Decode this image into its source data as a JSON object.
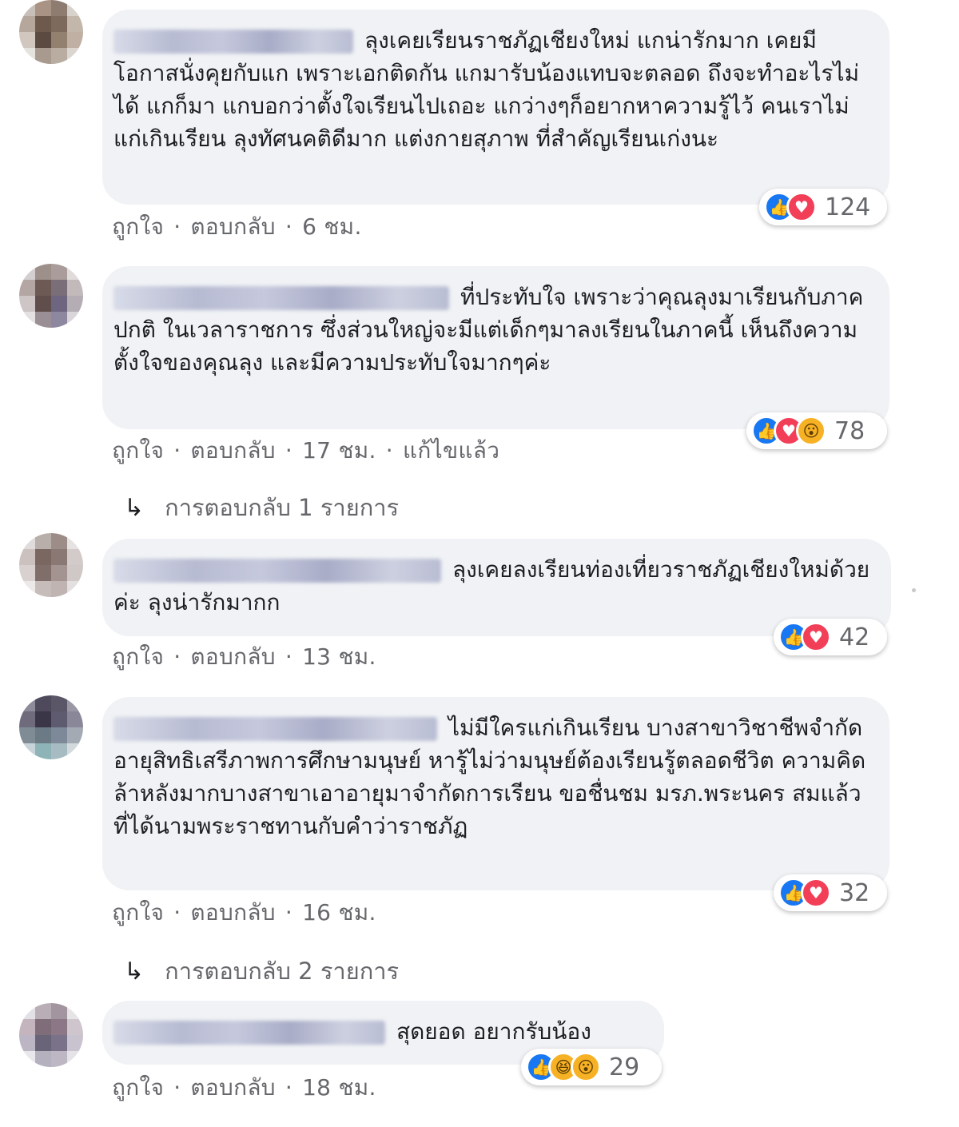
{
  "comments": [
    {
      "text": "ลุงเคยเรียนราชภัฏเชียงใหม่ แกน่ารักมาก เคยมีโอกาสนั่งคุยกับแก เพราะเอกติดกัน แกมารับน้องแทบจะตลอด ถึงจะทำอะไรไม่ได้ แกก็มา แกบอกว่าตั้งใจเรียนไปเถอะ แกว่างๆก็อยากหาความรู้ไว้ คนเราไม่แก่เกินเรียน ลุงทัศนคติดีมาก แต่งกายสุภาพ ที่สำคัญเรียนเก่งนะ",
      "like_label": "ถูกใจ",
      "reply_label": "ตอบกลับ",
      "time": "6 ชม.",
      "reactions": [
        "like",
        "love"
      ],
      "reaction_count": "124"
    },
    {
      "text": "ที่ประทับใจ เพราะว่าคุณลุงมาเรียนกับภาคปกติ ในเวลาราชการ ซึ่งส่วนใหญ่จะมีแต่เด็กๆมาลงเรียนในภาคนี้ เห็นถึงความตั้งใจของคุณลุง และมีความประทับใจมากๆค่ะ",
      "like_label": "ถูกใจ",
      "reply_label": "ตอบกลับ",
      "time": "17 ชม.",
      "edited": "แก้ไขแล้ว",
      "reactions": [
        "like",
        "love",
        "wow"
      ],
      "reaction_count": "78",
      "replies_link": "การตอบกลับ 1 รายการ"
    },
    {
      "text": "ลุงเคยลงเรียนท่องเที่ยวราชภัฏเชียงใหม่ด้วยค่ะ ลุงน่ารักมากก",
      "like_label": "ถูกใจ",
      "reply_label": "ตอบกลับ",
      "time": "13 ชม.",
      "reactions": [
        "like",
        "love"
      ],
      "reaction_count": "42"
    },
    {
      "text": "ไม่มีใครแก่เกินเรียน บางสาขาวิชาชีพจำกัดอายุสิทธิเสรีภาพการศึกษามนุษย์ หารู้ไม่ว่ามนุษย์ต้องเรียนรู้ตลอดชีวิต ความคิดล้าหลังมากบางสาขาเอาอายุมาจำกัดการเรียน ขอชื่นชม มรภ.พระนคร สมแล้วที่ได้นามพระราชทานกับคำว่าราชภัฏ",
      "like_label": "ถูกใจ",
      "reply_label": "ตอบกลับ",
      "time": "16 ชม.",
      "reactions": [
        "like",
        "love"
      ],
      "reaction_count": "32",
      "replies_link": "การตอบกลับ 2 รายการ"
    },
    {
      "text": "สุดยอด อยากรับน้อง",
      "like_label": "ถูกใจ",
      "reply_label": "ตอบกลับ",
      "time": "18 ชม.",
      "reactions": [
        "like",
        "haha",
        "wow"
      ],
      "reaction_count": "29"
    }
  ],
  "separator": "·",
  "reply_arrow": "↳",
  "colors": {
    "bubble": "#f0f2f5",
    "meta_text": "#65676b",
    "like": "#1877f2",
    "love": "#f33e58",
    "wow": "#f7b125"
  }
}
